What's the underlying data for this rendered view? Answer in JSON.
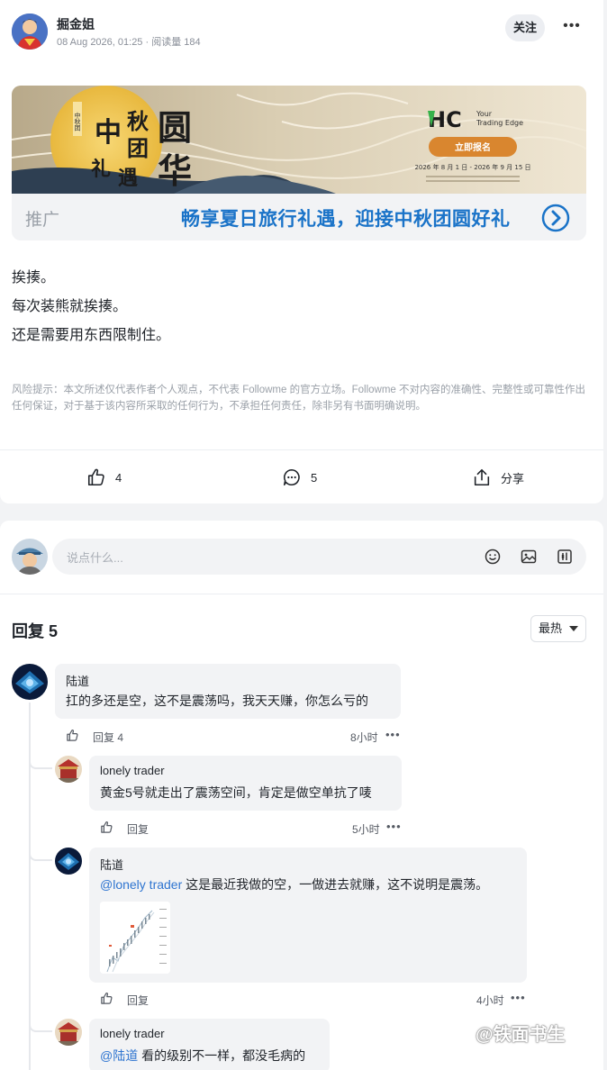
{
  "post": {
    "author": "掘金姐",
    "meta": "08 Aug 2026, 01:25 · 阅读量 184",
    "follow_label": "关注",
    "more_label": "•••",
    "lines": [
      "挨揍。",
      "每次装熊就挨揍。",
      "还是需要用东西限制住。"
    ],
    "risk_notice": "风险提示：本文所述仅代表作者个人观点，不代表 Followme 的官方立场。Followme 不对内容的准确性、完整性或可靠性作出任何保证，对于基于该内容所采取的任何行为，不承担任何责任，除非另有书面明确说明。"
  },
  "promo": {
    "label": "推广",
    "text": "畅享夏日旅行礼遇，迎接中秋团圆好礼",
    "art_title_1": "中秋团",
    "art_title_2": "礼遇好",
    "art_title_big": "圆华",
    "brand": "HC",
    "brand_tag": "Your Trading Edge",
    "cta": "立即报名",
    "dates": "2026 年 8 月 1 日 - 2026 年 9 月 15 日"
  },
  "actions": {
    "like_count": "4",
    "comment_count": "5",
    "share_label": "分享"
  },
  "composer": {
    "placeholder": "说点什么..."
  },
  "replies": {
    "title": "回复 5",
    "sort_label": "最热"
  },
  "comments": [
    {
      "name": "陆道",
      "text": "扛的多还是空，这不是震荡吗，我天天赚，你怎么亏的",
      "reply_label": "回复 4",
      "time": "8小时"
    },
    {
      "name": "lonely trader",
      "text": "黄金5号就走出了震荡空间，肯定是做空单抗了唛",
      "reply_label": "回复",
      "time": "5小时"
    },
    {
      "name": "陆道",
      "mention": "@lonely trader",
      "text": " 这是最近我做的空，一做进去就赚，这不说明是震荡。",
      "reply_label": "回复",
      "time": "4小时"
    },
    {
      "name": "lonely trader",
      "mention": "@陆道",
      "text": " 看的级别不一样，都没毛病的"
    }
  ],
  "watermark": "@铁面书生",
  "colors": {
    "accent": "#1a73c8",
    "mention": "#2e74d0",
    "bubble": "#f2f3f5"
  }
}
